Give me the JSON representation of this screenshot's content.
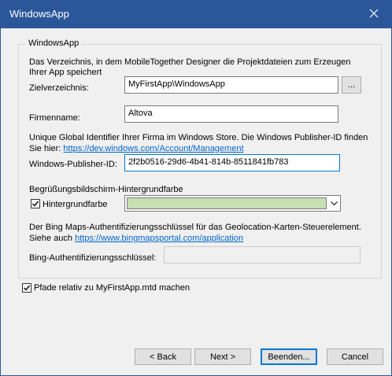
{
  "window": {
    "title": "WindowsApp"
  },
  "group": {
    "title": "WindowsApp",
    "directory_description_line1": "Das Verzeichnis, in dem MobileTogether Designer die Projektdateien zum Erzeugen",
    "directory_description_line2": "Ihrer App speichert",
    "target_dir_label": "Zielverzeichnis:",
    "target_dir_value": "MyFirstApp\\WindowsApp",
    "browse_label": "...",
    "company_label": "Firmenname:",
    "company_value": "Altova",
    "publisher_description_line1": "Unique Global Identifier Ihrer Firma im Windows Store. Die Windows Publisher-ID finden",
    "publisher_description_prefix": "Sie hier: ",
    "publisher_link": "https://dev.windows.com/Account/Management",
    "publisher_id_label": "Windows-Publisher-ID:",
    "publisher_id_value": "2f2b0516-29d6-4b41-814b-8511841fb783",
    "splash_section_label": "Begrüßungsbildschirm-Hintergrundfarbe",
    "bg_color_checkbox_label": "Hintergrundfarbe",
    "bg_color_checked": true,
    "bg_color_value": "#c6e0b4",
    "bing_description_line1": "Der Bing Maps-Authentifizierungsschlüssel für das Geolocation-Karten-Steuerelement.",
    "bing_description_prefix": "Siehe auch ",
    "bing_link": "https://www.bingmapsportal.com/application",
    "bing_key_label": "Bing-Authentifizierungsschlüssel:",
    "bing_key_value": ""
  },
  "relative_paths": {
    "label": "Pfade relativ zu MyFirstApp.mtd machen",
    "checked": true
  },
  "buttons": {
    "back": "< Back",
    "next": "Next >",
    "finish": "Beenden...",
    "cancel": "Cancel"
  },
  "colors": {
    "titlebar": "#2b579a",
    "link": "#0066cc",
    "focus_border": "#0078d7"
  }
}
